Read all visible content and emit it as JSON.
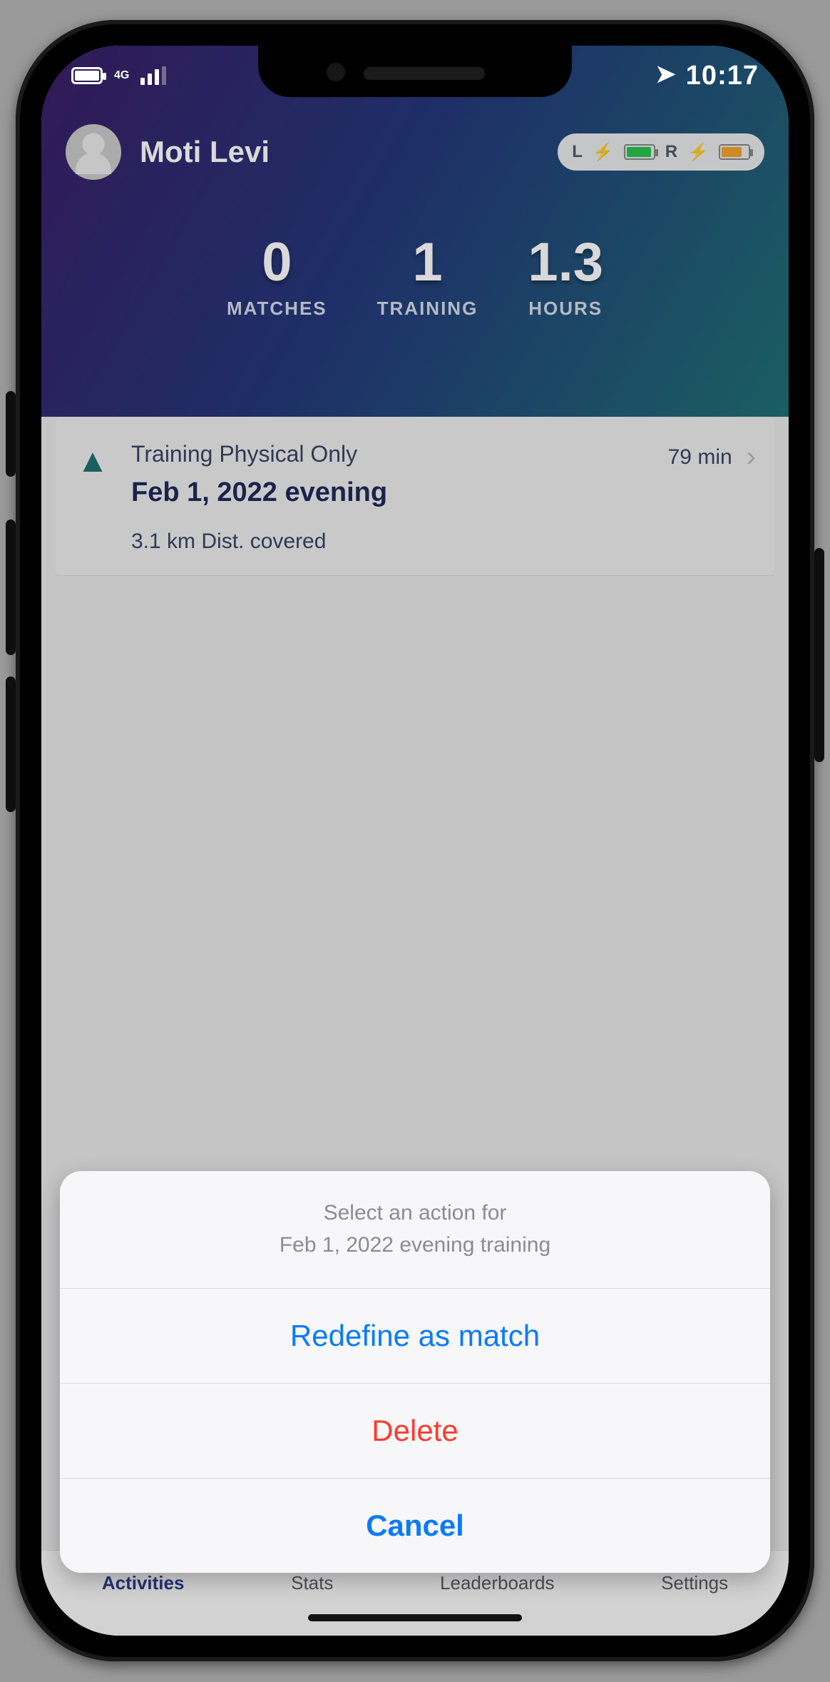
{
  "status": {
    "network": "4G",
    "time": "10:17"
  },
  "profile": {
    "name": "Moti Levi",
    "charge": {
      "left_label": "L",
      "right_label": "R"
    }
  },
  "summary": {
    "matches": {
      "value": "0",
      "label": "MATCHES"
    },
    "training": {
      "value": "1",
      "label": "TRAINING"
    },
    "hours": {
      "value": "1.3",
      "label": "HOURS"
    }
  },
  "activity": {
    "type": "Training Physical Only",
    "date": "Feb 1, 2022 evening",
    "distance": "3.1 km Dist. covered",
    "duration": "79 min"
  },
  "tabs": {
    "activities": "Activities",
    "stats": "Stats",
    "leaderboards": "Leaderboards",
    "settings": "Settings"
  },
  "sheet": {
    "title_line1": "Select an action for",
    "title_line2": "Feb 1, 2022 evening training",
    "redefine": "Redefine as match",
    "delete": "Delete",
    "cancel": "Cancel"
  }
}
